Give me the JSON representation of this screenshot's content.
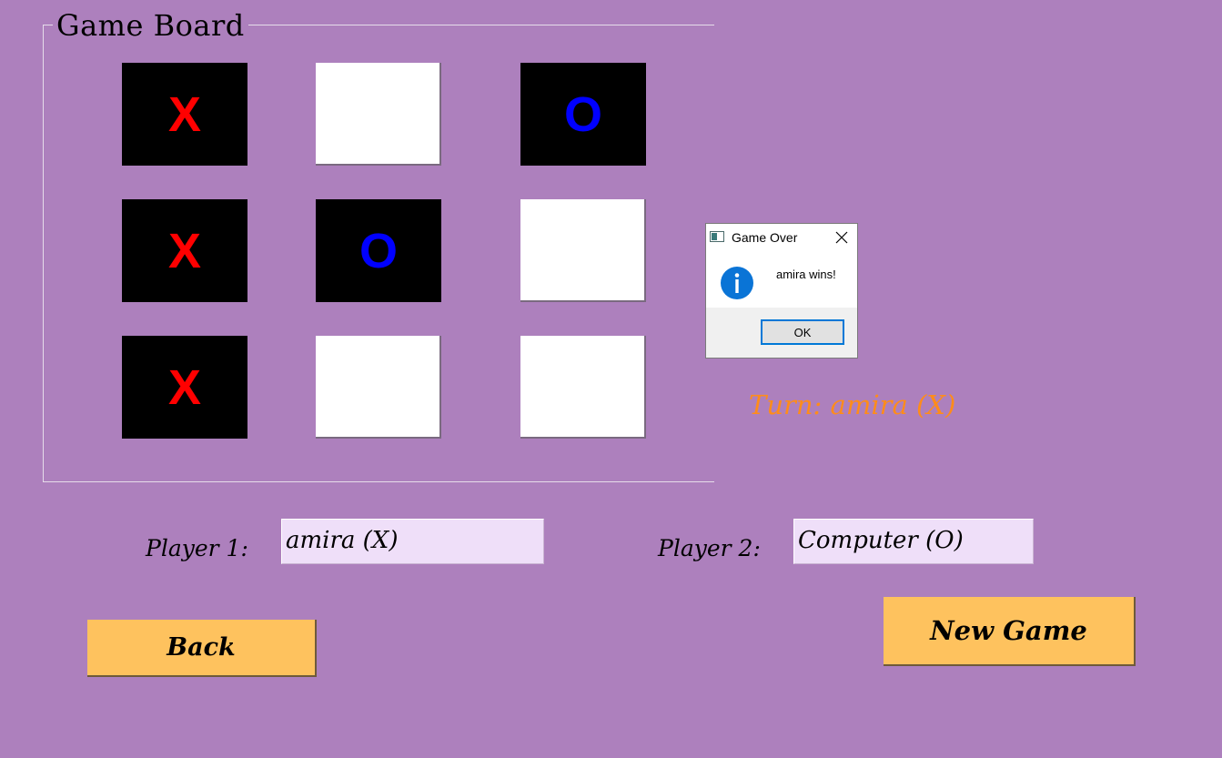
{
  "board": {
    "title": "Game Board",
    "cells": [
      {
        "mark": "X"
      },
      {
        "mark": ""
      },
      {
        "mark": "O"
      },
      {
        "mark": "X"
      },
      {
        "mark": "O"
      },
      {
        "mark": ""
      },
      {
        "mark": "X"
      },
      {
        "mark": ""
      },
      {
        "mark": ""
      }
    ]
  },
  "turn_label": "Turn: amira (X)",
  "players": {
    "player1_label": "Player 1:",
    "player1_value": "amira (X)",
    "player2_label": "Player 2:",
    "player2_value": "Computer (O)"
  },
  "buttons": {
    "back": "Back",
    "new_game": "New Game"
  },
  "dialog": {
    "title": "Game Over",
    "message": "amira wins!",
    "ok_label": "OK",
    "icon": "info-icon"
  },
  "colors": {
    "background": "#ad80bd",
    "x_mark": "#ff0000",
    "o_mark": "#0000ff",
    "turn_text": "#ff8c1a",
    "button": "#fec25e",
    "input_bg": "#efdff9"
  }
}
